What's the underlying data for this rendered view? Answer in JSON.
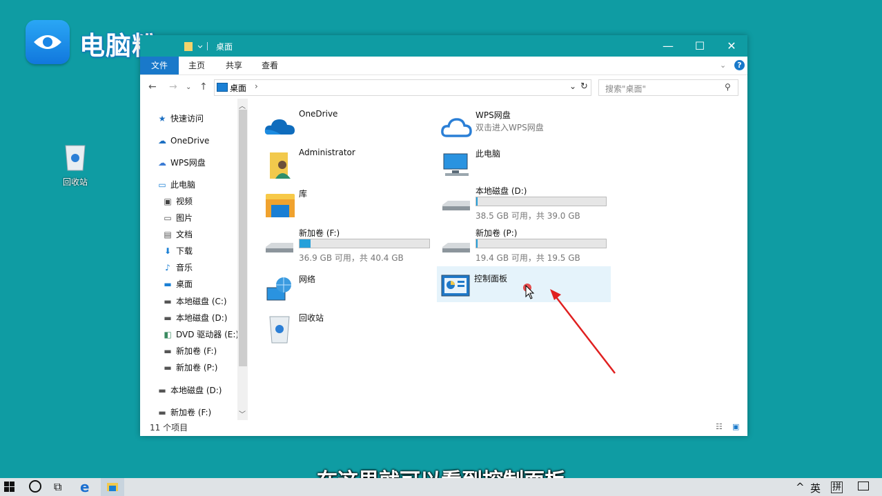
{
  "brand": {
    "logo_text": "电脑粉"
  },
  "desktop": {
    "recycle_bin_label": "回收站"
  },
  "window": {
    "title": "桌面",
    "controls": {
      "minimize": "—",
      "maximize": "☐",
      "close": "✕"
    },
    "ribbon_tabs": [
      "文件",
      "主页",
      "共享",
      "查看"
    ],
    "address": {
      "location": "桌面",
      "search_placeholder": "搜索\"桌面\""
    },
    "nav_pane": [
      {
        "label": "快速访问",
        "icon": "star-icon"
      },
      {
        "label": "OneDrive",
        "icon": "cloud-icon"
      },
      {
        "label": "WPS网盘",
        "icon": "cloud-outline-icon"
      },
      {
        "label": "此电脑",
        "icon": "computer-icon"
      },
      {
        "label": "视频",
        "icon": "video-icon"
      },
      {
        "label": "图片",
        "icon": "picture-icon"
      },
      {
        "label": "文档",
        "icon": "document-icon"
      },
      {
        "label": "下载",
        "icon": "download-icon"
      },
      {
        "label": "音乐",
        "icon": "music-icon"
      },
      {
        "label": "桌面",
        "icon": "desktop-icon"
      },
      {
        "label": "本地磁盘 (C:)",
        "icon": "drive-icon"
      },
      {
        "label": "本地磁盘 (D:)",
        "icon": "drive-icon"
      },
      {
        "label": "DVD 驱动器 (E:)",
        "icon": "dvd-icon"
      },
      {
        "label": "新加卷 (F:)",
        "icon": "drive-icon"
      },
      {
        "label": "新加卷 (P:)",
        "icon": "drive-icon"
      },
      {
        "label": "本地磁盘 (D:)",
        "icon": "drive-icon"
      },
      {
        "label": "新加卷 (F:)",
        "icon": "drive-icon"
      }
    ],
    "items": {
      "onedrive": {
        "name": "OneDrive"
      },
      "wps": {
        "name": "WPS网盘",
        "sub": "双击进入WPS网盘"
      },
      "admin": {
        "name": "Administrator"
      },
      "thispc": {
        "name": "此电脑"
      },
      "library": {
        "name": "库"
      },
      "drive_d": {
        "name": "本地磁盘 (D:)",
        "free": "38.5 GB 可用，共 39.0 GB",
        "used_fraction": 0.013
      },
      "drive_f": {
        "name": "新加卷 (F:)",
        "free": "36.9 GB 可用，共 40.4 GB",
        "used_fraction": 0.087
      },
      "drive_p": {
        "name": "新加卷 (P:)",
        "free": "19.4 GB 可用，共 19.5 GB",
        "used_fraction": 0.005
      },
      "network": {
        "name": "网络"
      },
      "control_panel": {
        "name": "控制面板"
      },
      "recycle": {
        "name": "回收站"
      }
    },
    "status": "11 个项目"
  },
  "subtitle": "在这里就可以看到控制面板",
  "taskbar": {
    "tray_lang": "英",
    "tray_ime": "拼",
    "tray_arrow": "^"
  },
  "colors": {
    "desktop": "#0f9ca3",
    "accent": "#1979ca",
    "selection": "#e5f3fb",
    "arrow": "#e02020"
  }
}
